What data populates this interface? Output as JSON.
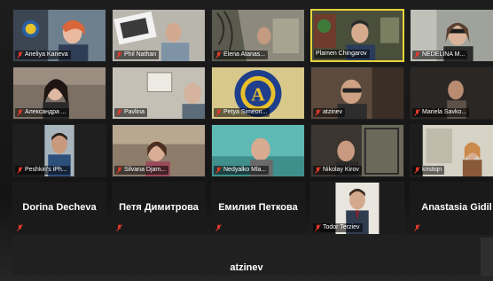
{
  "meeting": {
    "participants": [
      {
        "label": "Aneliya Kaneva",
        "muted": true,
        "video": true
      },
      {
        "label": "Phil Nathan",
        "muted": true,
        "video": true
      },
      {
        "label": "Elena Atanas...",
        "muted": true,
        "video": true
      },
      {
        "label": "Plamen Chingarov",
        "muted": false,
        "video": true,
        "active_speaker": true
      },
      {
        "label": "NEDELINA M...",
        "muted": true,
        "video": true
      },
      {
        "label": "Александра ...",
        "muted": true,
        "video": true
      },
      {
        "label": "Pavlina",
        "muted": true,
        "video": true
      },
      {
        "label": "Petya Simeon...",
        "muted": true,
        "video": true
      },
      {
        "label": "atzinev",
        "muted": true,
        "video": true
      },
      {
        "label": "Mariela Savko...",
        "muted": true,
        "video": true
      },
      {
        "label": "Peshkin's iPh...",
        "muted": true,
        "video": true
      },
      {
        "label": "Silvana Djam...",
        "muted": true,
        "video": true
      },
      {
        "label": "Nedyalko Mla...",
        "muted": true,
        "video": true
      },
      {
        "label": "Nikolay Kirov",
        "muted": true,
        "video": true
      },
      {
        "label": "kristiqn",
        "muted": true,
        "video": true
      },
      {
        "label": "Dorina Decheva",
        "muted": true,
        "video": false
      },
      {
        "label": "Петя Димитрова",
        "muted": true,
        "video": false
      },
      {
        "label": "Емилия Петкова",
        "muted": true,
        "video": false
      },
      {
        "label": "Todor Terziev",
        "muted": true,
        "video": true
      },
      {
        "label": "Anastasia Gidil",
        "muted": true,
        "video": false
      }
    ],
    "bottom_participant": {
      "label": "atzinev",
      "video": false
    },
    "colors": {
      "active_border": "#e6d43a",
      "mute_icon": "#e0392b",
      "tile_bg": "#1f1f1f"
    }
  }
}
